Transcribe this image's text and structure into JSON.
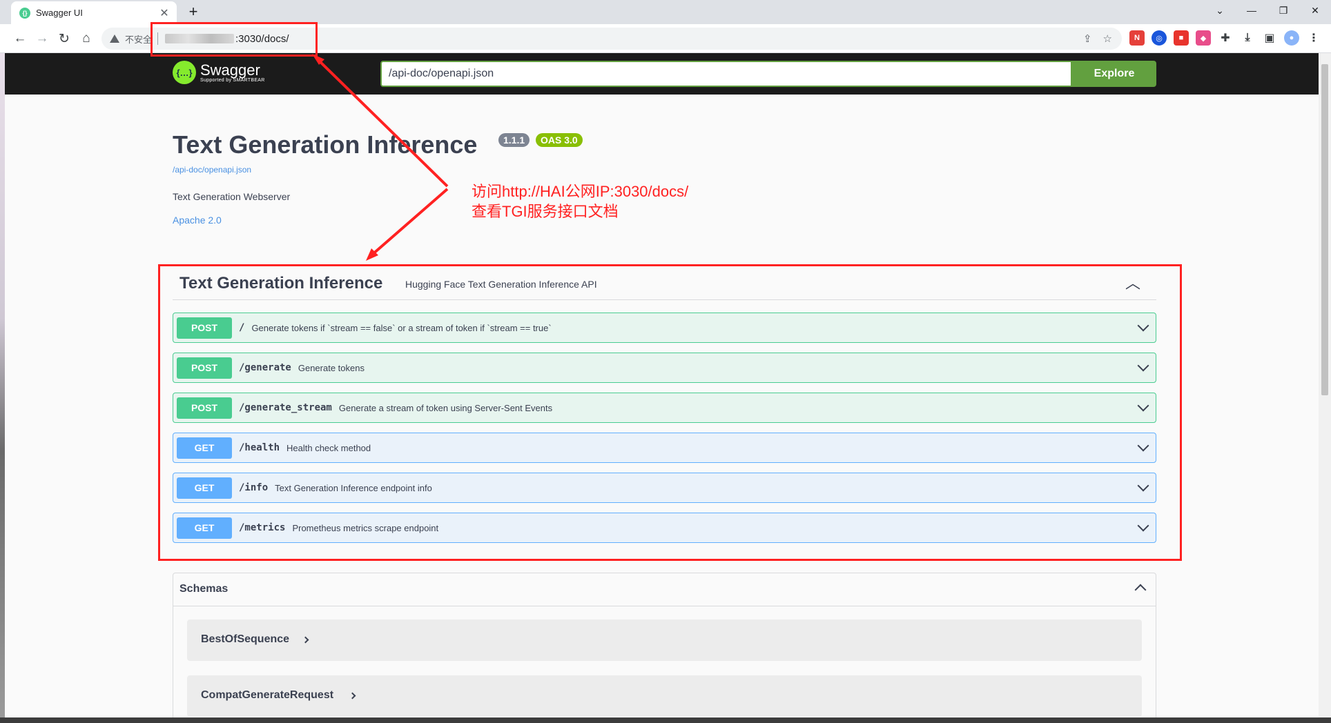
{
  "browser": {
    "tab_title": "Swagger UI",
    "tab_close": "✕",
    "new_tab": "+",
    "insecure_label": "不安全",
    "url_visible": ":3030/docs/"
  },
  "swagger_topbar": {
    "logo_text": "Swagger",
    "logo_sub": "Supported by SMARTBEAR",
    "spec_url_value": "/api-doc/openapi.json",
    "explore_label": "Explore"
  },
  "info": {
    "title": "Text Generation Inference",
    "version_badge": "1.1.1",
    "oas_badge": "OAS 3.0",
    "spec_link": "/api-doc/openapi.json",
    "description": "Text Generation Webserver",
    "license": "Apache 2.0"
  },
  "tag": {
    "name": "Text Generation Inference",
    "description": "Hugging Face Text Generation Inference API"
  },
  "operations": [
    {
      "method": "POST",
      "path": "/",
      "summary": "Generate tokens if `stream == false` or a stream of token if `stream == true`"
    },
    {
      "method": "POST",
      "path": "/generate",
      "summary": "Generate tokens"
    },
    {
      "method": "POST",
      "path": "/generate_stream",
      "summary": "Generate a stream of token using Server-Sent Events"
    },
    {
      "method": "GET",
      "path": "/health",
      "summary": "Health check method"
    },
    {
      "method": "GET",
      "path": "/info",
      "summary": "Text Generation Inference endpoint info"
    },
    {
      "method": "GET",
      "path": "/metrics",
      "summary": "Prometheus metrics scrape endpoint"
    }
  ],
  "schemas": {
    "title": "Schemas",
    "models": [
      "BestOfSequence",
      "CompatGenerateRequest"
    ]
  },
  "annotation": {
    "line1": "访问http://HAI公网IP:3030/docs/",
    "line2": "查看TGI服务接口文档",
    "color": "#ff2121"
  },
  "colors": {
    "post": "#49cc90",
    "get": "#61affe",
    "explore": "#62a03f",
    "topbar": "#1b1b1b"
  }
}
